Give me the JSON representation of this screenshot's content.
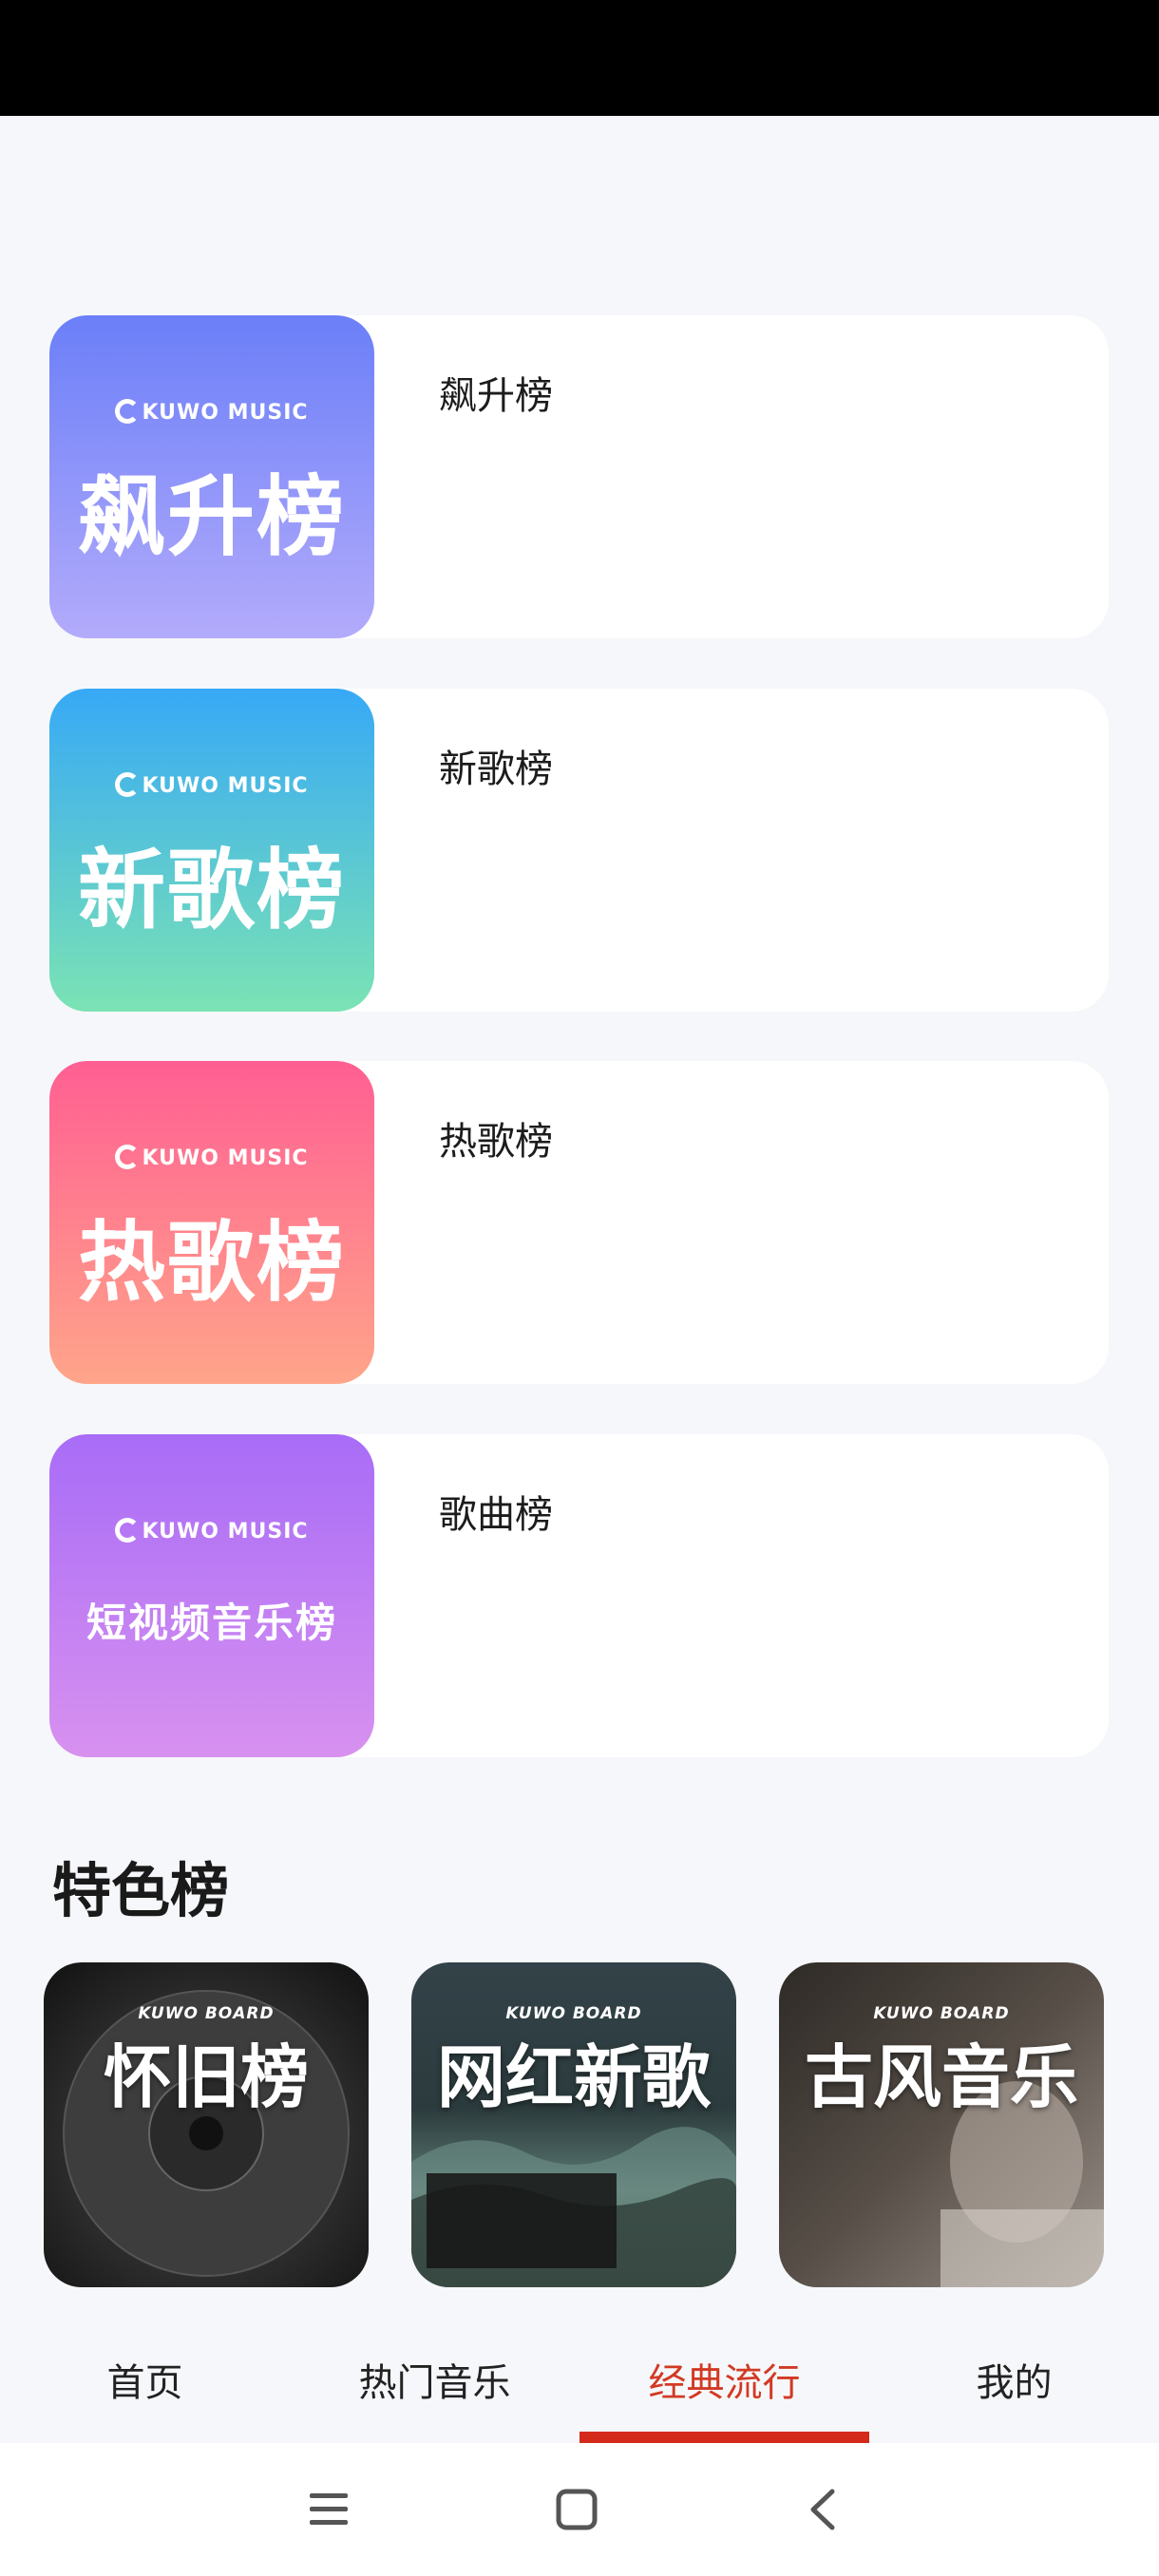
{
  "brand": "KUWO MUSIC",
  "board_brand": "KUWO BOARD",
  "ranks": [
    {
      "name": "飙升榜",
      "cover_title": "飙升榜",
      "gradient": [
        "#6b7ff8",
        "#b3abfb"
      ]
    },
    {
      "name": "新歌榜",
      "cover_title": "新歌榜",
      "gradient": [
        "#37a9f6",
        "#7be3b4"
      ]
    },
    {
      "name": "热歌榜",
      "cover_title": "热歌榜",
      "gradient": [
        "#ff5f92",
        "#ffa58a"
      ]
    },
    {
      "name": "歌曲榜",
      "cover_title": "短视频音乐榜",
      "gradient": [
        "#a86cf7",
        "#d891ef"
      ]
    }
  ],
  "section_title": "特色榜",
  "features": [
    {
      "title": "怀旧榜",
      "bg": [
        "#3a3a3a",
        "#1a1a1a"
      ]
    },
    {
      "title": "网红新歌",
      "bg": [
        "#2b3a3e",
        "#556a6a"
      ]
    },
    {
      "title": "古风音乐",
      "bg": [
        "#3b3530",
        "#6d645c"
      ]
    }
  ],
  "nav": {
    "items": [
      "首页",
      "热门音乐",
      "经典流行",
      "我的"
    ],
    "active_index": 2,
    "active_color": "#d23a24"
  },
  "sys_nav": [
    "menu-icon",
    "home-square-icon",
    "back-chevron-icon"
  ]
}
